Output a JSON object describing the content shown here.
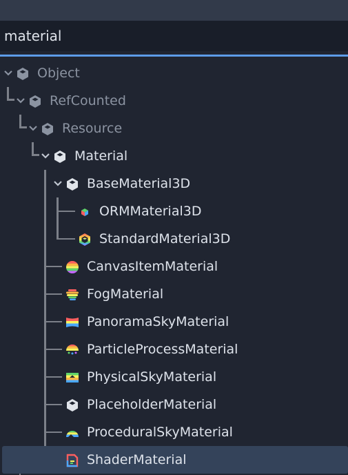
{
  "search": {
    "value": "material"
  },
  "tree": {
    "nodes": [
      {
        "label": "Object",
        "icon": "object-cube-icon"
      },
      {
        "label": "RefCounted",
        "icon": "object-cube-icon"
      },
      {
        "label": "Resource",
        "icon": "object-cube-icon"
      },
      {
        "label": "Material",
        "icon": "object-cube-icon"
      },
      {
        "label": "BaseMaterial3D",
        "icon": "object-cube-icon"
      },
      {
        "label": "ORMMaterial3D",
        "icon": "orm-material-icon"
      },
      {
        "label": "StandardMaterial3D",
        "icon": "standard-material-icon"
      },
      {
        "label": "CanvasItemMaterial",
        "icon": "canvas-item-material-icon"
      },
      {
        "label": "FogMaterial",
        "icon": "fog-material-icon"
      },
      {
        "label": "PanoramaSkyMaterial",
        "icon": "panorama-sky-material-icon"
      },
      {
        "label": "ParticleProcessMaterial",
        "icon": "particle-process-material-icon"
      },
      {
        "label": "PhysicalSkyMaterial",
        "icon": "physical-sky-material-icon"
      },
      {
        "label": "PlaceholderMaterial",
        "icon": "object-cube-icon"
      },
      {
        "label": "ProceduralSkyMaterial",
        "icon": "procedural-sky-material-icon"
      },
      {
        "label": "ShaderMaterial",
        "icon": "shader-material-icon"
      }
    ]
  },
  "colors": {
    "background": "#202531",
    "search_bg": "#191e29",
    "accent": "#5d9ce8",
    "selected_row": "#34435a",
    "text_bright": "#dde2ea",
    "text_dim": "#8b93a1"
  }
}
